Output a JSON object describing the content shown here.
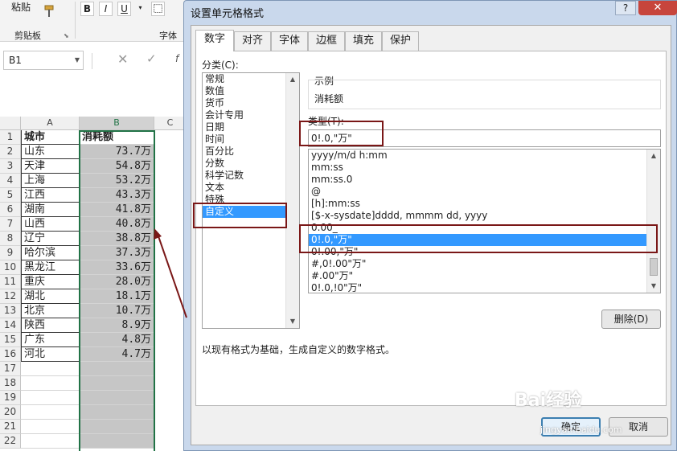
{
  "ribbon": {
    "paste_label": "粘贴",
    "clipboard_group": "剪贴板",
    "font_group": "字体",
    "bold": "B",
    "italic": "I",
    "underline": "U"
  },
  "name_box": {
    "value": "B1"
  },
  "formula_bar": {
    "cancel": "✕",
    "enter": "✓",
    "fx": "f"
  },
  "sheet": {
    "columns": [
      "A",
      "B",
      "C"
    ],
    "rows": [
      {
        "n": "1",
        "a": "城市",
        "b": "消耗额"
      },
      {
        "n": "2",
        "a": "山东",
        "b": "73.7万"
      },
      {
        "n": "3",
        "a": "天津",
        "b": "54.8万"
      },
      {
        "n": "4",
        "a": "上海",
        "b": "53.2万"
      },
      {
        "n": "5",
        "a": "江西",
        "b": "43.3万"
      },
      {
        "n": "6",
        "a": "湖南",
        "b": "41.8万"
      },
      {
        "n": "7",
        "a": "山西",
        "b": "40.8万"
      },
      {
        "n": "8",
        "a": "辽宁",
        "b": "38.8万"
      },
      {
        "n": "9",
        "a": "哈尔滨",
        "b": "37.3万"
      },
      {
        "n": "10",
        "a": "黑龙江",
        "b": "33.6万"
      },
      {
        "n": "11",
        "a": "重庆",
        "b": "28.0万"
      },
      {
        "n": "12",
        "a": "湖北",
        "b": "18.1万"
      },
      {
        "n": "13",
        "a": "北京",
        "b": "10.7万"
      },
      {
        "n": "14",
        "a": "陕西",
        "b": "8.9万"
      },
      {
        "n": "15",
        "a": "广东",
        "b": "4.8万"
      },
      {
        "n": "16",
        "a": "河北",
        "b": "4.7万"
      },
      {
        "n": "17",
        "a": "",
        "b": ""
      },
      {
        "n": "18",
        "a": "",
        "b": ""
      },
      {
        "n": "19",
        "a": "",
        "b": ""
      },
      {
        "n": "20",
        "a": "",
        "b": ""
      },
      {
        "n": "21",
        "a": "",
        "b": ""
      },
      {
        "n": "22",
        "a": "",
        "b": ""
      }
    ]
  },
  "dialog": {
    "title": "设置单元格格式",
    "help": "?",
    "close": "✕",
    "tabs": [
      "数字",
      "对齐",
      "字体",
      "边框",
      "填充",
      "保护"
    ],
    "category_label": "分类(C):",
    "categories": [
      "常规",
      "数值",
      "货币",
      "会计专用",
      "日期",
      "时间",
      "百分比",
      "分数",
      "科学记数",
      "文本",
      "特殊",
      "自定义"
    ],
    "selected_category": "自定义",
    "sample_label": "示例",
    "sample_value": "消耗额",
    "type_label": "类型(T):",
    "type_value": "0!.0,\"万\"",
    "formats": [
      "yyyy/m/d h:mm",
      "mm:ss",
      "mm:ss.0",
      "@",
      "[h]:mm:ss",
      "[$-x-sysdate]dddd, mmmm dd, yyyy",
      "0.00_",
      "0!.0,\"万\"",
      "0!.00,\"万\"",
      "#,0!.00\"万\"",
      "#.00\"万\"",
      "0!.0,!0\"万\""
    ],
    "selected_format": "0!.0,\"万\"",
    "delete_button": "删除(D)",
    "description": "以现有格式为基础，生成自定义的数字格式。",
    "ok_button": "确定",
    "cancel_button": "取消"
  },
  "watermark": {
    "brand": "Bai经验",
    "url": "jingyan.baidu.com"
  },
  "colors": {
    "highlight": "#7a1717",
    "selection": "#3399ff",
    "excel_green": "#217346"
  }
}
